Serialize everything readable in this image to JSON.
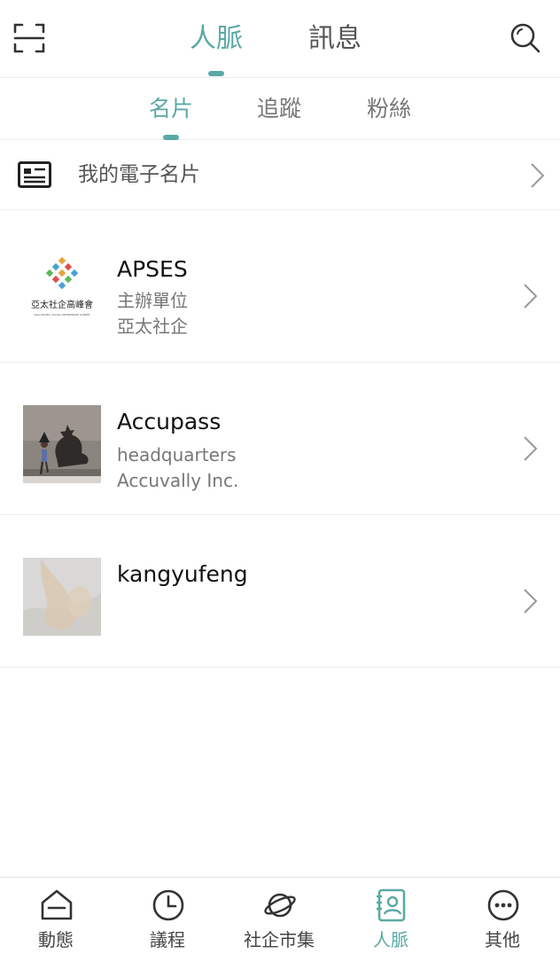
{
  "header": {
    "tabs": [
      {
        "label": "人脈",
        "active": true
      },
      {
        "label": "訊息",
        "active": false
      }
    ],
    "left_icon": "scan-icon",
    "right_icon": "search-icon"
  },
  "subtabs": [
    {
      "label": "名片",
      "active": true
    },
    {
      "label": "追蹤",
      "active": false
    },
    {
      "label": "粉絲",
      "active": false
    }
  ],
  "my_card": {
    "label": "我的電子名片",
    "icon": "business-card-icon"
  },
  "contacts": [
    {
      "name": "APSES",
      "line1": "主辦單位",
      "line2": "亞太社企",
      "logo_text": "亞太社企高峰會",
      "logo_subtext": "ASIA PACIFIC SOCIAL ENTERPRISE SUMMIT"
    },
    {
      "name": "Accupass",
      "line1": "headquarters",
      "line2": "Accuvally Inc."
    },
    {
      "name": "kangyufeng",
      "line1": "",
      "line2": ""
    }
  ],
  "bottom_nav": [
    {
      "label": "動態",
      "icon": "home-icon",
      "active": false
    },
    {
      "label": "議程",
      "icon": "clock-icon",
      "active": false
    },
    {
      "label": "社企市集",
      "icon": "planet-icon",
      "active": false
    },
    {
      "label": "人脈",
      "icon": "contacts-icon",
      "active": true
    },
    {
      "label": "其他",
      "icon": "more-icon",
      "active": false
    }
  ],
  "colors": {
    "accent": "#5aa9a6",
    "text_primary": "#111111",
    "text_secondary": "#777777",
    "divider": "#ececec"
  }
}
